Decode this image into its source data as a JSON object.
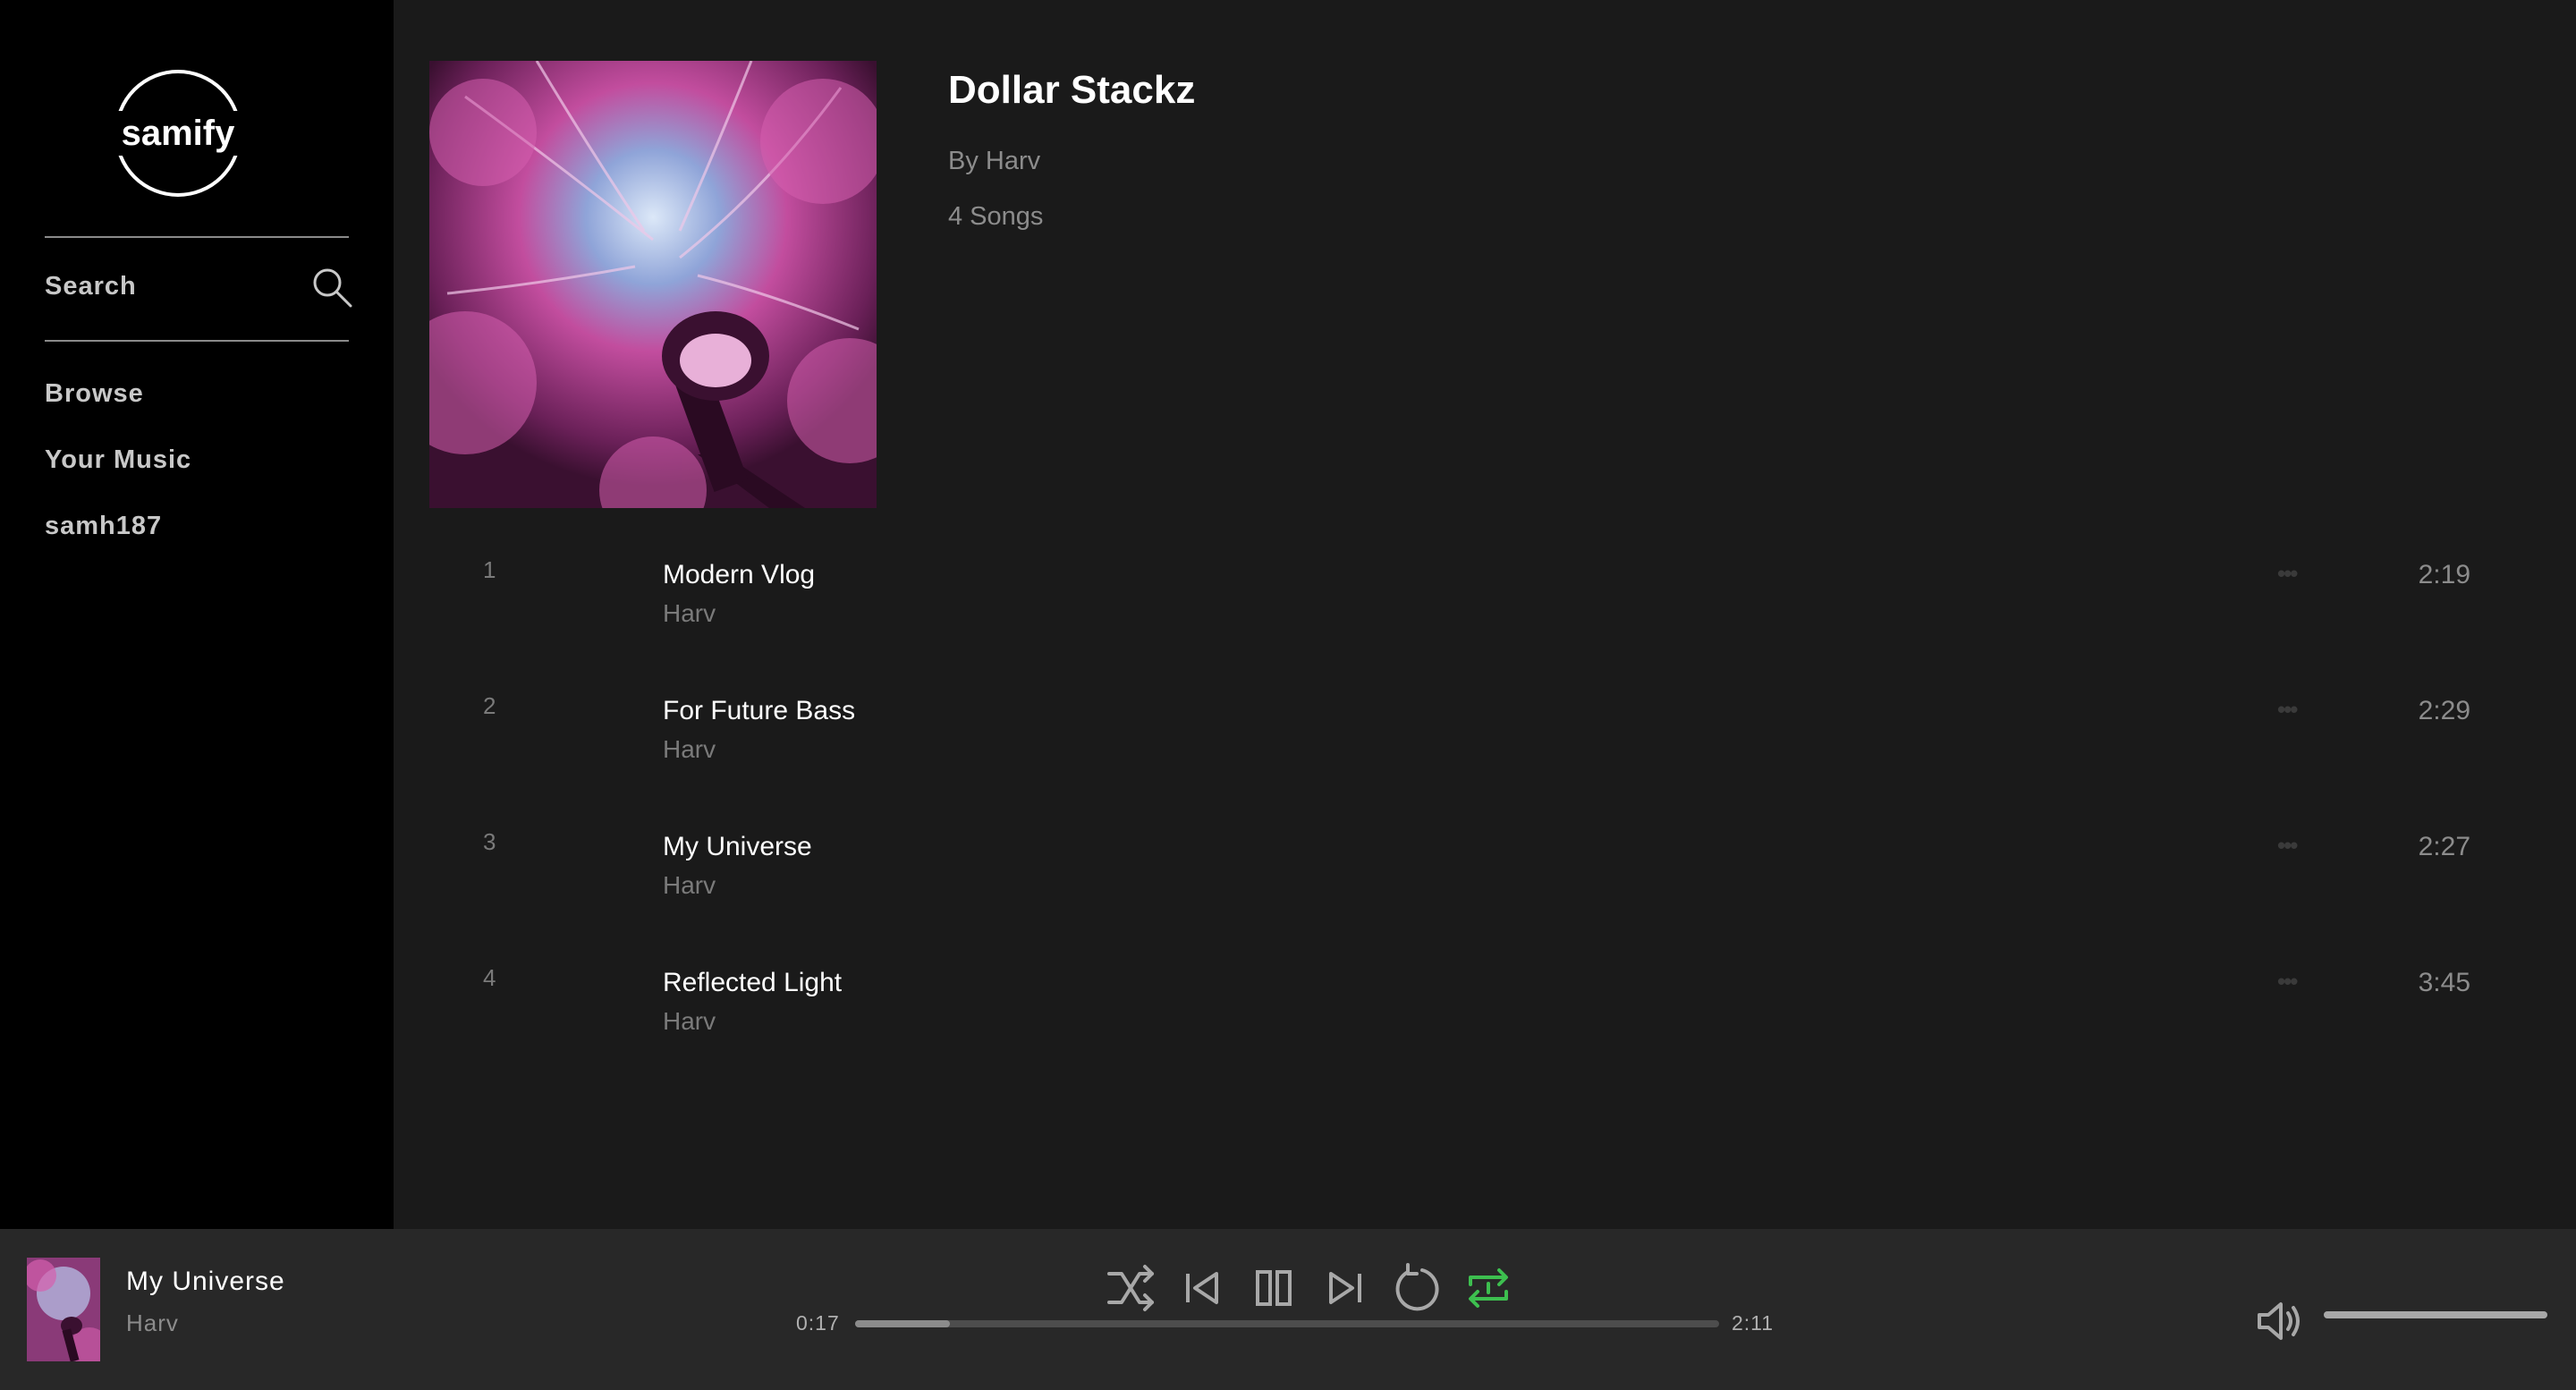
{
  "app": {
    "logo_text": "samify"
  },
  "sidebar": {
    "search_label": "Search",
    "items": [
      {
        "label": "Browse"
      },
      {
        "label": "Your Music"
      },
      {
        "label": "samh187"
      }
    ]
  },
  "album": {
    "title": "Dollar Stackz",
    "artist": "By Harv",
    "song_count": "4 Songs",
    "tracks": [
      {
        "number": "1",
        "title": "Modern Vlog",
        "artist": "Harv",
        "more": "•••",
        "duration": "2:19"
      },
      {
        "number": "2",
        "title": "For Future Bass",
        "artist": "Harv",
        "more": "•••",
        "duration": "2:29"
      },
      {
        "number": "3",
        "title": "My Universe",
        "artist": "Harv",
        "more": "•••",
        "duration": "2:27"
      },
      {
        "number": "4",
        "title": "Reflected Light",
        "artist": "Harv",
        "more": "•••",
        "duration": "3:45"
      }
    ]
  },
  "player": {
    "now_playing": {
      "title": "My Universe",
      "artist": "Harv"
    },
    "elapsed": "0:17",
    "total": "2:11",
    "progress_fraction": 0.11,
    "volume_fraction": 1.0,
    "repeat_active": true,
    "icons": [
      "shuffle-icon",
      "previous-icon",
      "pause-icon",
      "next-icon",
      "replay-icon",
      "repeat-icon",
      "volume-icon"
    ]
  },
  "colors": {
    "sidebar_bg": "#000000",
    "main_bg": "#1a1a1a",
    "player_bg": "#282828",
    "accent_green": "#3dbf4f",
    "text_primary": "#ffffff",
    "text_muted": "#8c8c8c"
  }
}
